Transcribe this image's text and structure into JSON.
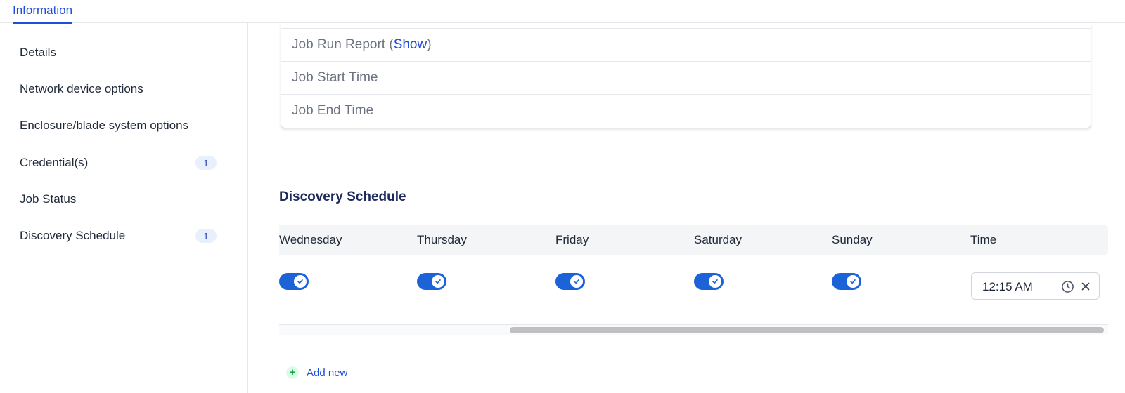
{
  "tabs": [
    {
      "label": "Information",
      "active": true
    }
  ],
  "sidebar": {
    "items": [
      {
        "label": "Details",
        "badge": ""
      },
      {
        "label": "Network device options",
        "badge": ""
      },
      {
        "label": "Enclosure/blade system options",
        "badge": ""
      },
      {
        "label": "Credential(s)",
        "badge": "1"
      },
      {
        "label": "Job Status",
        "badge": ""
      },
      {
        "label": "Discovery Schedule",
        "badge": "1"
      }
    ]
  },
  "job_info": {
    "run_report_label": "Job Run Report (",
    "run_report_link": "Show",
    "run_report_close": ")",
    "start_time_label": "Job Start Time",
    "end_time_label": "Job End Time"
  },
  "discovery_schedule": {
    "title": "Discovery Schedule",
    "columns": [
      "Wednesday",
      "Thursday",
      "Friday",
      "Saturday",
      "Sunday",
      "Time"
    ],
    "rows": [
      {
        "wednesday": true,
        "thursday": true,
        "friday": true,
        "saturday": true,
        "sunday": true,
        "time": "12:15 AM"
      }
    ],
    "add_new_label": "Add new"
  },
  "colors": {
    "accent": "#1d4ed8",
    "toggle_on": "#1d63d8",
    "heading": "#1e2a5e",
    "badge_bg": "#e8f0fb",
    "add_icon": "#16a34a"
  },
  "icons": [
    "check-icon",
    "clock-icon",
    "close-icon",
    "plus-icon"
  ]
}
